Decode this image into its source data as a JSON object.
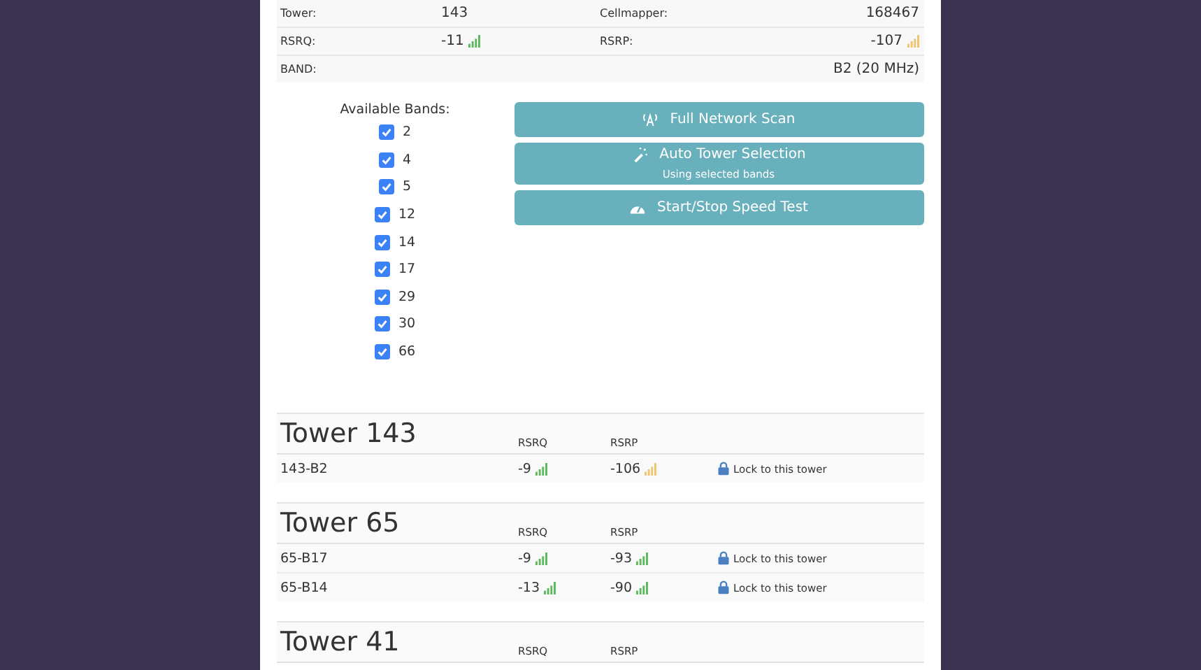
{
  "info_rows": [
    {
      "cells": [
        {
          "label": "Tower:",
          "value": "143"
        },
        {
          "label": "Cellmapper:",
          "value": "168467"
        }
      ]
    },
    {
      "cells": [
        {
          "label": "RSRQ:",
          "value": "-11",
          "color": "#5cb85c"
        },
        {
          "label": "RSRP:",
          "value": "-107",
          "color": "#f0c36d"
        }
      ]
    },
    {
      "cells": [
        {
          "label": "BAND:"
        },
        {
          "value": "B2 (20 MHz)"
        }
      ]
    }
  ],
  "bands": {
    "label": "Available Bands:",
    "items": [
      {
        "label": "2",
        "checked": true
      },
      {
        "label": "4",
        "checked": true
      },
      {
        "label": "5",
        "checked": true
      },
      {
        "label": "12",
        "checked": true
      },
      {
        "label": "14",
        "checked": true
      },
      {
        "label": "17",
        "checked": true
      },
      {
        "label": "29",
        "checked": true
      },
      {
        "label": "30",
        "checked": true
      },
      {
        "label": "66",
        "checked": true
      }
    ]
  },
  "actions": [
    {
      "kind": "scan",
      "label": "Full Network Scan"
    },
    {
      "kind": "auto",
      "label": "Auto Tower Selection",
      "sublabel": "Using selected bands"
    },
    {
      "kind": "speed",
      "label": "Start/Stop Speed Test"
    }
  ],
  "towers": [
    {
      "title": "Tower 143",
      "col_1": "RSRQ",
      "col_2": "RSRP",
      "rows": [
        {
          "name": "143-B2",
          "rsrq": {
            "value": "-9",
            "color": "#5cb85c"
          },
          "rsrp": {
            "value": "-106",
            "color": "#f0c36d"
          },
          "action": "Lock to this tower"
        }
      ]
    },
    {
      "title": "Tower 65",
      "col_1": "RSRQ",
      "col_2": "RSRP",
      "rows": [
        {
          "name": "65-B17",
          "rsrq": {
            "value": "-9",
            "color": "#5cb85c"
          },
          "rsrp": {
            "value": "-93",
            "color": "#5cb85c"
          },
          "action": "Lock to this tower"
        },
        {
          "name": "65-B14",
          "rsrq": {
            "value": "-13",
            "color": "#5cb85c"
          },
          "rsrp": {
            "value": "-90",
            "color": "#5cb85c"
          },
          "action": "Lock to this tower"
        }
      ]
    },
    {
      "title": "Tower 41",
      "col_1": "RSRQ",
      "col_2": "RSRP"
    }
  ]
}
